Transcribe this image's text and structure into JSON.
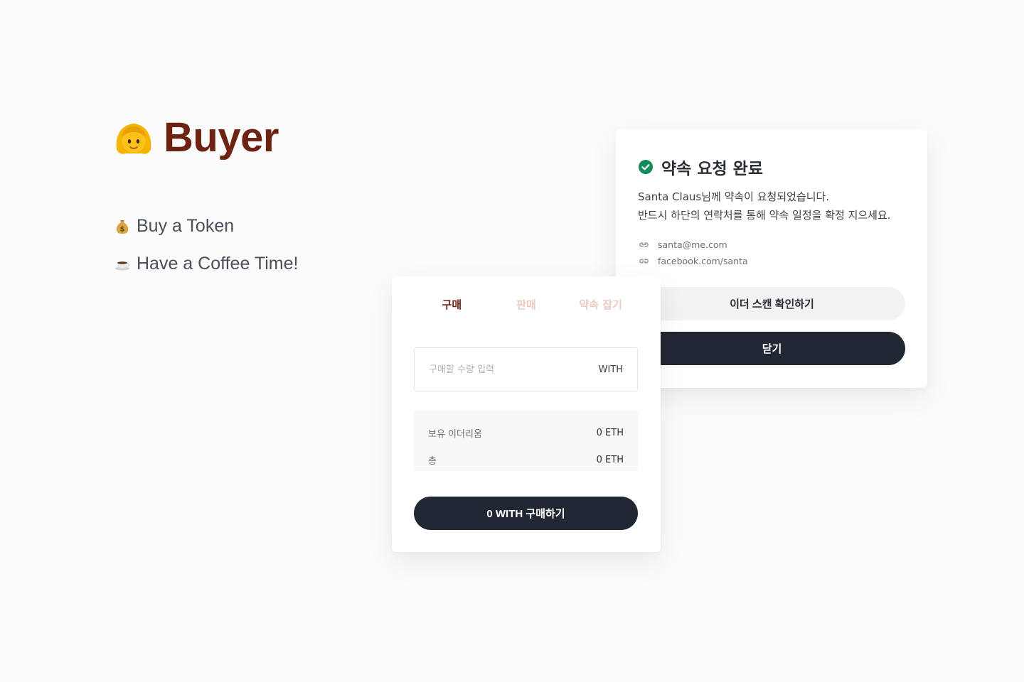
{
  "hero": {
    "title": "Buyer",
    "title_icon": "person-blond-hair-emoji",
    "menu": [
      {
        "icon": "money-bag-icon",
        "label": "Buy a Token"
      },
      {
        "icon": "coffee-cup-icon",
        "label": "Have a Coffee Time!"
      }
    ]
  },
  "colors": {
    "brand": "#6e2211",
    "tab_inactive": "#eccbc2",
    "dark_button": "#222734",
    "light_button": "#f2f2f3",
    "success": "#178a5a"
  },
  "confirm_dialog": {
    "status_icon": "check-circle-icon",
    "title": "약속 요청 완료",
    "message_line1": "Santa Claus님께 약속이 요청되었습니다.",
    "message_line2": "반드시 하단의 연락처를 통해 약속 일정을 확정 지으세요.",
    "contacts": [
      {
        "icon": "link-icon",
        "text": "santa@me.com"
      },
      {
        "icon": "link-icon",
        "text": "facebook.com/santa"
      }
    ],
    "ether_scan_label": "이더 스캔 확인하기",
    "close_label": "닫기"
  },
  "buy_panel": {
    "tabs": [
      {
        "label": "구매",
        "active": true
      },
      {
        "label": "판매",
        "active": false
      },
      {
        "label": "약속 잡기",
        "active": false
      }
    ],
    "amount_input": {
      "placeholder": "구매할 수량 입력",
      "value": "",
      "unit": "WITH"
    },
    "summary": [
      {
        "label": "보유 이더리움",
        "value": "0 ETH"
      },
      {
        "label": "총",
        "value": "0 ETH"
      }
    ],
    "buy_button_label": "0 WITH 구매하기"
  }
}
